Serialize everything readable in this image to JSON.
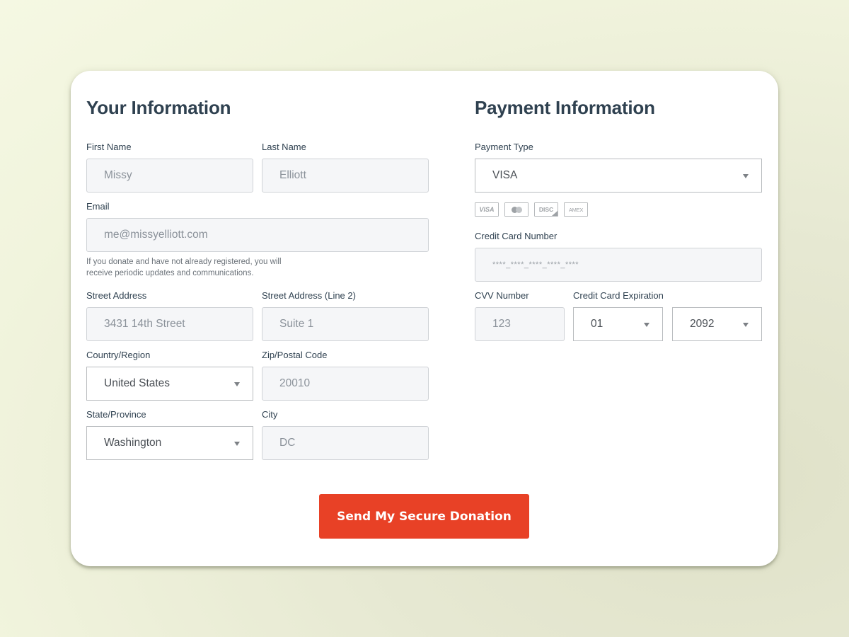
{
  "your_info": {
    "title": "Your Information",
    "first_name": {
      "label": "First Name",
      "value": "Missy"
    },
    "last_name": {
      "label": "Last Name",
      "value": "Elliott"
    },
    "email": {
      "label": "Email",
      "value": "me@missyelliott.com",
      "help_line1": "If you donate and have not already registered, you will",
      "help_line2": "receive periodic updates and communications."
    },
    "street": {
      "label": "Street Address",
      "value": "3431 14th Street"
    },
    "street2": {
      "label": "Street Address (Line 2)",
      "value": "Suite 1"
    },
    "country": {
      "label": "Country/Region",
      "value": "United States"
    },
    "zip": {
      "label": "Zip/Postal Code",
      "value": "20010"
    },
    "state": {
      "label": "State/Province",
      "value": "Washington"
    },
    "city": {
      "label": "City",
      "value": "DC"
    }
  },
  "payment_info": {
    "title": "Payment Information",
    "payment_type": {
      "label": "Payment Type",
      "value": "VISA"
    },
    "card_logos": [
      {
        "name": "visa",
        "text": "VISA"
      },
      {
        "name": "mastercard",
        "text": ""
      },
      {
        "name": "discover",
        "text": "DISC"
      },
      {
        "name": "amex",
        "text": "AMEX"
      }
    ],
    "card_number": {
      "label": "Credit Card Number",
      "value": "****_****_****_****_****"
    },
    "cvv": {
      "label": "CVV Number",
      "value": "123"
    },
    "expiration": {
      "label": "Credit Card Expiration",
      "month": "01",
      "year": "2092"
    }
  },
  "submit": {
    "label": "Send My Secure Donation",
    "color": "#e84126"
  }
}
